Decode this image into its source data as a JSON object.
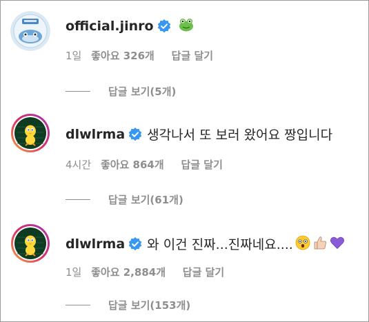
{
  "comments": [
    {
      "username": "official.jinro",
      "text": "",
      "emoji": "frog-emoji",
      "time": "1일",
      "likes": "좋아요 326개",
      "reply_label": "답글 달기",
      "view_replies": "답글 보기(5개)"
    },
    {
      "username": "dlwlrma",
      "text": "생각나서 또 보러 왔어요 짱입니다",
      "emoji": "",
      "time": "4시간",
      "likes": "좋아요 864개",
      "reply_label": "답글 달기",
      "view_replies": "답글 보기(61개)"
    },
    {
      "username": "dlwlrma",
      "text": "와 이건 진짜...진짜네요....",
      "emoji": "astonished-face, thumbs-up, purple-heart",
      "time": "1일",
      "likes": "좋아요 2,884개",
      "reply_label": "답글 달기",
      "view_replies": "답글 보기(153개)"
    }
  ],
  "colors": {
    "verified_blue": "#3897f0",
    "secondary_text": "#8e8e8e",
    "primary_text": "#262626",
    "purple_heart": "#8a5cd8",
    "frog_green": "#5cb85c"
  }
}
